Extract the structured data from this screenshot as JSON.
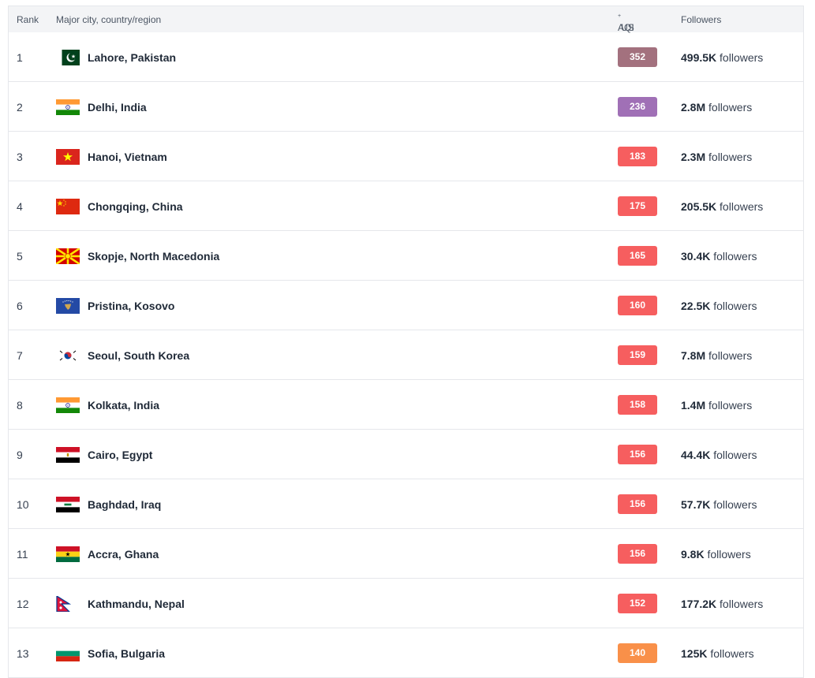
{
  "header": {
    "rank": "Rank",
    "city": "Major city, country/region",
    "aqi_prefix": "AQI",
    "aqi_sup": "+",
    "aqi_suffix": " US",
    "followers": "Followers"
  },
  "rows": [
    {
      "rank": "1",
      "city": "Lahore, Pakistan",
      "flag": "pakistan-flag-icon",
      "aqi": "352",
      "aqi_color": "#a3717e",
      "followers": "499.5K",
      "followers_suffix": " followers"
    },
    {
      "rank": "2",
      "city": "Delhi, India",
      "flag": "india-flag-icon",
      "aqi": "236",
      "aqi_color": "#a070b6",
      "followers": "2.8M",
      "followers_suffix": " followers"
    },
    {
      "rank": "3",
      "city": "Hanoi, Vietnam",
      "flag": "vietnam-flag-icon",
      "aqi": "183",
      "aqi_color": "#f65e5f",
      "followers": "2.3M",
      "followers_suffix": " followers"
    },
    {
      "rank": "4",
      "city": "Chongqing, China",
      "flag": "china-flag-icon",
      "aqi": "175",
      "aqi_color": "#f65e5f",
      "followers": "205.5K",
      "followers_suffix": " followers"
    },
    {
      "rank": "5",
      "city": "Skopje, North Macedonia",
      "flag": "north-macedonia-flag-icon",
      "aqi": "165",
      "aqi_color": "#f65e5f",
      "followers": "30.4K",
      "followers_suffix": " followers"
    },
    {
      "rank": "6",
      "city": "Pristina, Kosovo",
      "flag": "kosovo-flag-icon",
      "aqi": "160",
      "aqi_color": "#f65e5f",
      "followers": "22.5K",
      "followers_suffix": " followers"
    },
    {
      "rank": "7",
      "city": "Seoul, South Korea",
      "flag": "south-korea-flag-icon",
      "aqi": "159",
      "aqi_color": "#f65e5f",
      "followers": "7.8M",
      "followers_suffix": " followers"
    },
    {
      "rank": "8",
      "city": "Kolkata, India",
      "flag": "india-flag-icon",
      "aqi": "158",
      "aqi_color": "#f65e5f",
      "followers": "1.4M",
      "followers_suffix": " followers"
    },
    {
      "rank": "9",
      "city": "Cairo, Egypt",
      "flag": "egypt-flag-icon",
      "aqi": "156",
      "aqi_color": "#f65e5f",
      "followers": "44.4K",
      "followers_suffix": " followers"
    },
    {
      "rank": "10",
      "city": "Baghdad, Iraq",
      "flag": "iraq-flag-icon",
      "aqi": "156",
      "aqi_color": "#f65e5f",
      "followers": "57.7K",
      "followers_suffix": " followers"
    },
    {
      "rank": "11",
      "city": "Accra, Ghana",
      "flag": "ghana-flag-icon",
      "aqi": "156",
      "aqi_color": "#f65e5f",
      "followers": "9.8K",
      "followers_suffix": " followers"
    },
    {
      "rank": "12",
      "city": "Kathmandu, Nepal",
      "flag": "nepal-flag-icon",
      "aqi": "152",
      "aqi_color": "#f65e5f",
      "followers": "177.2K",
      "followers_suffix": " followers"
    },
    {
      "rank": "13",
      "city": "Sofia, Bulgaria",
      "flag": "bulgaria-flag-icon",
      "aqi": "140",
      "aqi_color": "#f99049",
      "followers": "125K",
      "followers_suffix": " followers"
    }
  ]
}
